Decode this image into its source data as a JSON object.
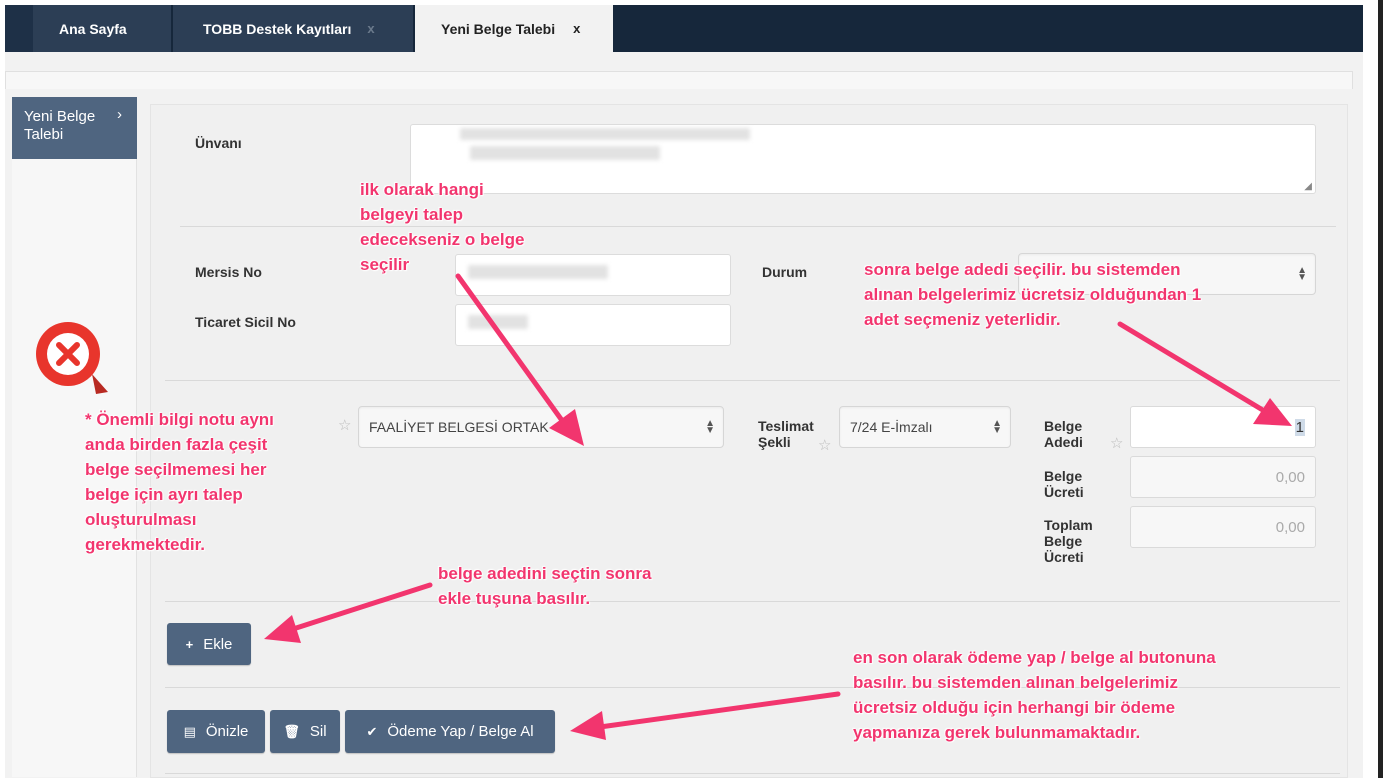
{
  "tabs": [
    {
      "label": "Ana Sayfa",
      "close": ""
    },
    {
      "label": "TOBB Destek Kayıtları",
      "close": "x"
    },
    {
      "label": "Yeni Belge Talebi",
      "close": "x"
    }
  ],
  "sidebar": {
    "item_label": "Yeni Belge Talebi",
    "chevron": "›"
  },
  "form": {
    "unvan_label": "Ünvanı",
    "mersis_label": "Mersis No",
    "sicil_label": "Ticaret Sicil No",
    "durum_label": "Durum",
    "belge_select_value": "FAALİYET BELGESİ ORTAK",
    "teslimat_label_1": "Teslimat",
    "teslimat_label_2": "Şekli",
    "teslimat_value": "7/24 E-İmzalı",
    "adet_label_1": "Belge",
    "adet_label_2": "Adedi",
    "adet_value": "1",
    "ucret_label_1": "Belge",
    "ucret_label_2": "Ücreti",
    "ucret_value": "0,00",
    "toplam_label_1": "Toplam",
    "toplam_label_2": "Belge",
    "toplam_label_3": "Ücreti",
    "toplam_value": "0,00"
  },
  "buttons": {
    "ekle": "Ekle",
    "onizle": "Önizle",
    "sil": "Sil",
    "odeme": "Ödeme Yap / Belge Al"
  },
  "annotations": {
    "first": [
      "ilk olarak hangi",
      "belgeyi talep",
      "edecekseniz o belge",
      "seçilir"
    ],
    "second": [
      "sonra belge adedi seçilir. bu sistemden",
      "alınan belgelerimiz ücretsiz olduğundan 1",
      "adet seçmeniz yeterlidir."
    ],
    "note": [
      "* Önemli bilgi notu aynı",
      "anda birden fazla çeşit",
      "belge seçilmemesi her",
      "belge için ayrı talep",
      "oluşturulması",
      "gerekmektedir."
    ],
    "ekle_hint": [
      "belge adedini seçtin sonra",
      "ekle tuşuna basılır."
    ],
    "last": [
      "en son olarak ödeme yap / belge al butonuna",
      "basılır. bu sistemden alınan belgelerimiz",
      "ücretsiz olduğu için herhangi bir ödeme",
      "yapmanıza gerek bulunmamaktadır."
    ]
  },
  "colors": {
    "annotation": "#f2356e",
    "button": "#4f6580",
    "tabbar": "#16273b",
    "warning_icon": "#e8352c"
  },
  "icons": {
    "warning": "x-mark-pin-icon",
    "ekle": "plus-icon",
    "onizle": "document-icon",
    "sil": "trash-icon",
    "odeme": "check-icon",
    "star": "star-icon"
  }
}
